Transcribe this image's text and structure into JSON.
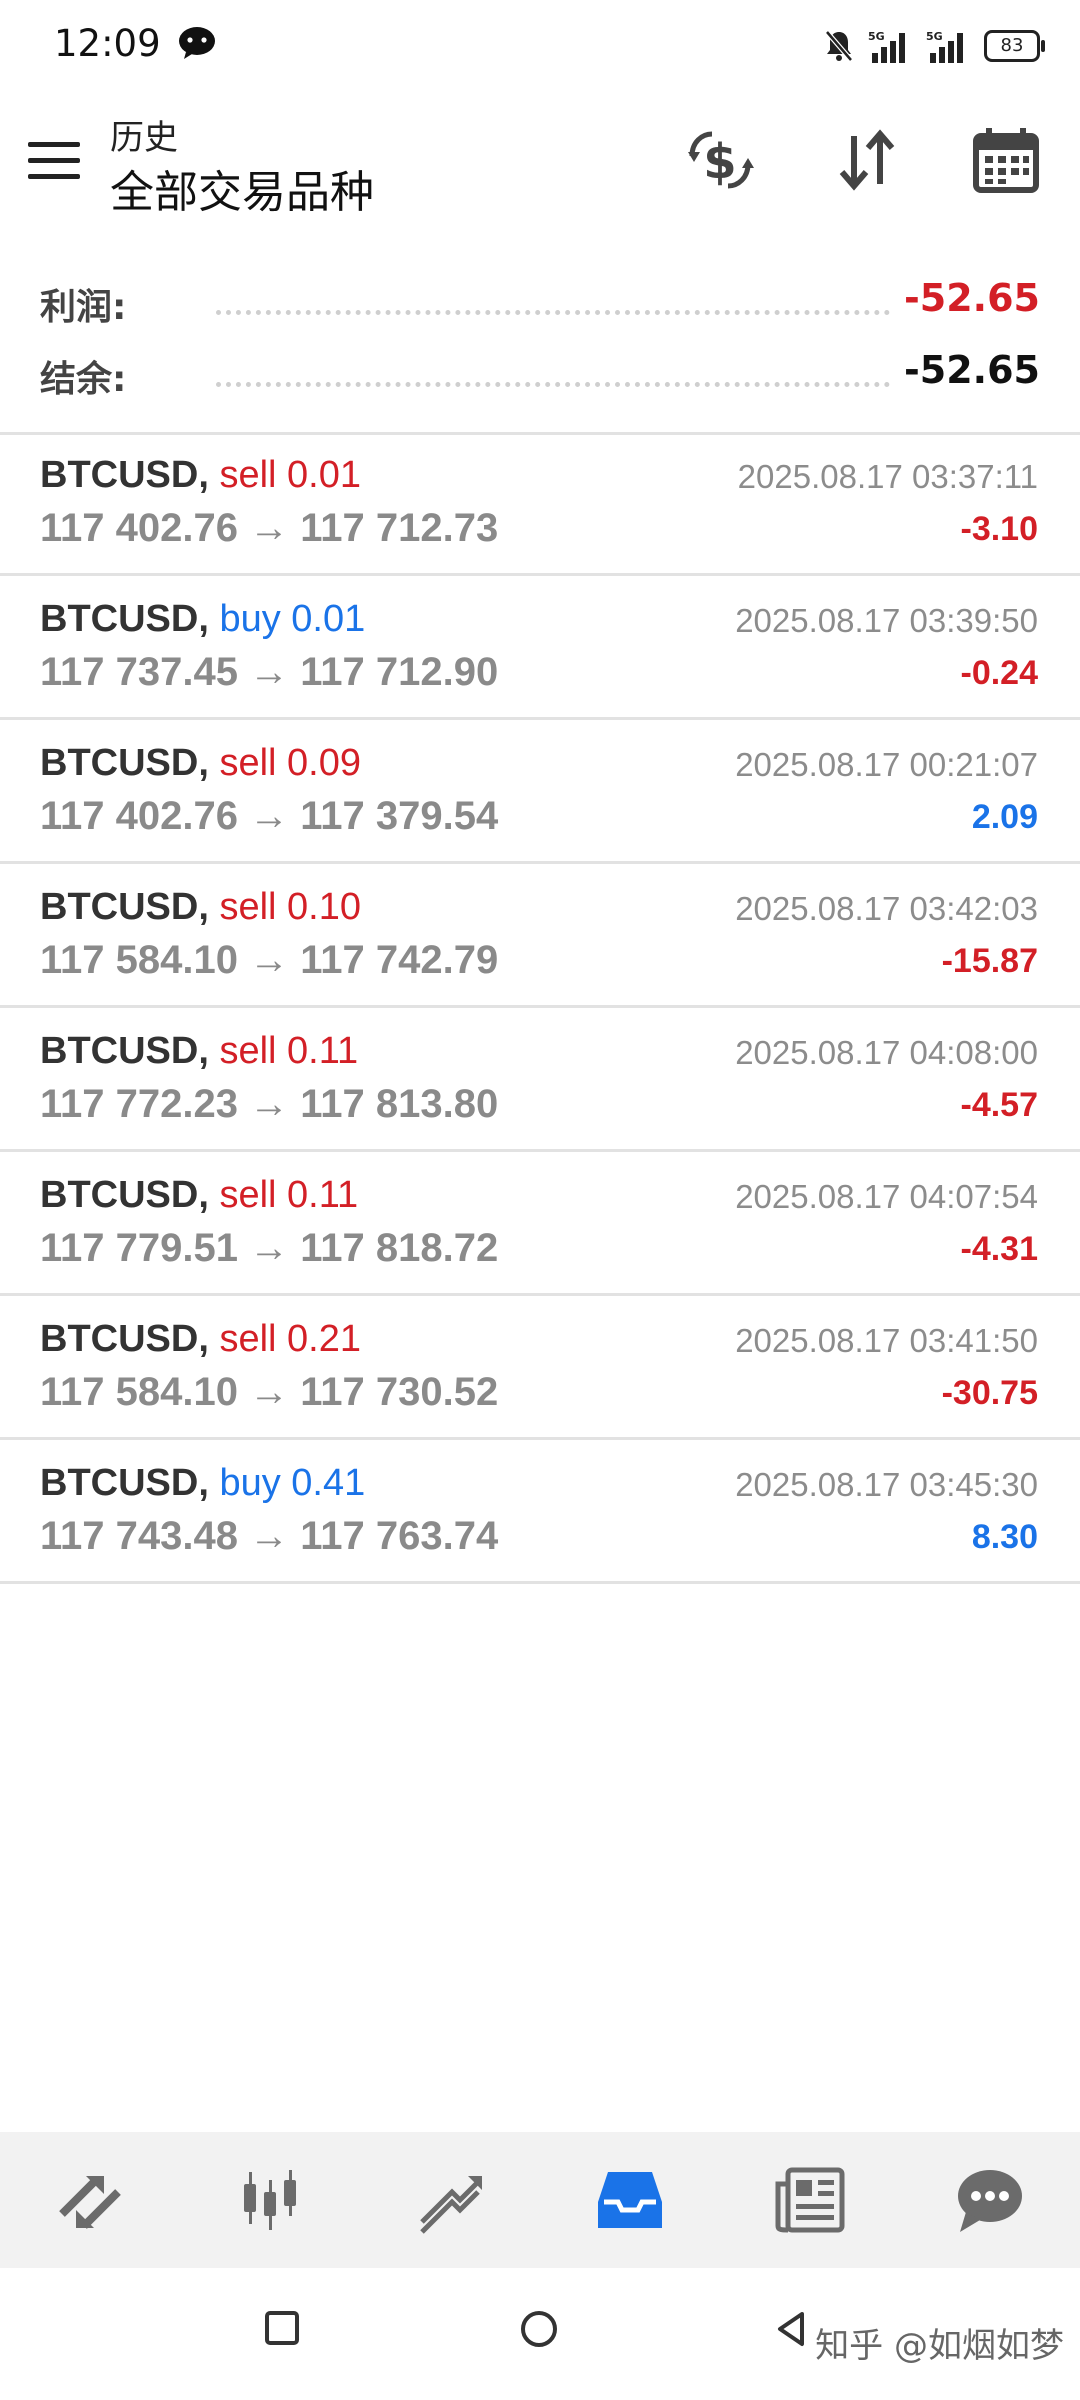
{
  "status_bar": {
    "time": "12:09",
    "battery": "83"
  },
  "header": {
    "subtitle": "历史",
    "title": "全部交易品种",
    "icons": [
      "currency-exchange-icon",
      "sort-icon",
      "calendar-icon"
    ]
  },
  "summary": {
    "profit_label": "利润:",
    "profit_value": "-52.65",
    "balance_label": "结余:",
    "balance_value": "-52.65"
  },
  "trades": [
    {
      "symbol": "BTCUSD,",
      "side": "sell 0.01",
      "prices": "117 402.76 → 117 712.73",
      "date": "2025.08.17 03:37:11",
      "pl": "-3.10",
      "side_color": "#d31f26",
      "pl_color": "#d31f26"
    },
    {
      "symbol": "BTCUSD,",
      "side": "buy 0.01",
      "prices": "117 737.45 → 117 712.90",
      "date": "2025.08.17 03:39:50",
      "pl": "-0.24",
      "side_color": "#1a73e8",
      "pl_color": "#d31f26"
    },
    {
      "symbol": "BTCUSD,",
      "side": "sell 0.09",
      "prices": "117 402.76 → 117 379.54",
      "date": "2025.08.17 00:21:07",
      "pl": "2.09",
      "side_color": "#d31f26",
      "pl_color": "#1a73e8"
    },
    {
      "symbol": "BTCUSD,",
      "side": "sell 0.10",
      "prices": "117 584.10 → 117 742.79",
      "date": "2025.08.17 03:42:03",
      "pl": "-15.87",
      "side_color": "#d31f26",
      "pl_color": "#d31f26"
    },
    {
      "symbol": "BTCUSD,",
      "side": "sell 0.11",
      "prices": "117 772.23 → 117 813.80",
      "date": "2025.08.17 04:08:00",
      "pl": "-4.57",
      "side_color": "#d31f26",
      "pl_color": "#d31f26"
    },
    {
      "symbol": "BTCUSD,",
      "side": "sell 0.11",
      "prices": "117 779.51 → 117 818.72",
      "date": "2025.08.17 04:07:54",
      "pl": "-4.31",
      "side_color": "#d31f26",
      "pl_color": "#d31f26"
    },
    {
      "symbol": "BTCUSD,",
      "side": "sell 0.21",
      "prices": "117 584.10 → 117 730.52",
      "date": "2025.08.17 03:41:50",
      "pl": "-30.75",
      "side_color": "#d31f26",
      "pl_color": "#d31f26"
    },
    {
      "symbol": "BTCUSD,",
      "side": "buy 0.41",
      "prices": "117 743.48 → 117 763.74",
      "date": "2025.08.17 03:45:30",
      "pl": "8.30",
      "side_color": "#1a73e8",
      "pl_color": "#1a73e8"
    }
  ],
  "tabs": [
    "quotes-icon",
    "chart-icon",
    "trade-icon",
    "history-icon",
    "news-icon",
    "messages-icon"
  ],
  "active_tab": "history-icon",
  "colors": {
    "loss": "#d31f26",
    "gain": "#1a73e8",
    "active_tab": "#1a73e8",
    "inactive_tab": "#6b6b6b"
  },
  "watermark": "知乎 @如烟如梦"
}
